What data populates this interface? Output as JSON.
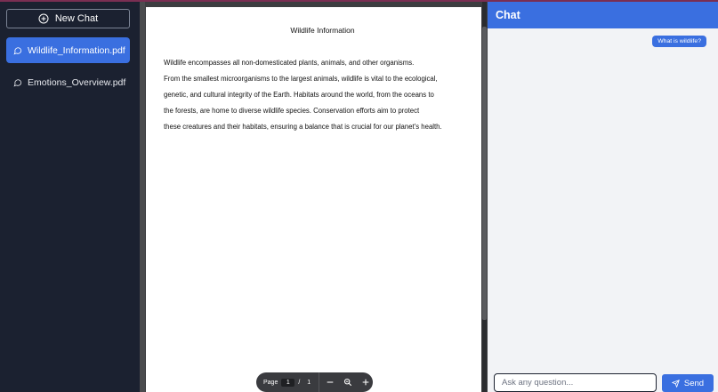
{
  "sidebar": {
    "new_chat_label": "New Chat",
    "files": [
      {
        "name": "Wildlife_Information.pdf",
        "active": true
      },
      {
        "name": "Emotions_Overview.pdf",
        "active": false
      }
    ]
  },
  "document": {
    "title": "Wildlife Information",
    "lines": [
      "Wildlife encompasses all non-domesticated plants, animals, and other organisms.",
      "From the smallest microorganisms to the largest animals, wildlife is vital to the ecological,",
      "genetic, and cultural integrity of the Earth. Habitats around the world, from the oceans to",
      "the forests, are home to diverse wildlife species. Conservation efforts aim to protect",
      "these creatures and their habitats, ensuring a balance that is crucial for our planet's health."
    ]
  },
  "pager": {
    "page_label": "Page",
    "current_page": "1",
    "separator": "/",
    "total_pages": "1"
  },
  "chat": {
    "title": "Chat",
    "messages": [
      {
        "role": "user",
        "text": "What is wildlife?"
      }
    ],
    "input_placeholder": "Ask any question...",
    "send_label": "Send"
  },
  "colors": {
    "accent": "#3a6fe0",
    "sidebar_bg": "#1b2130",
    "chat_bg": "#f2f3f6"
  }
}
